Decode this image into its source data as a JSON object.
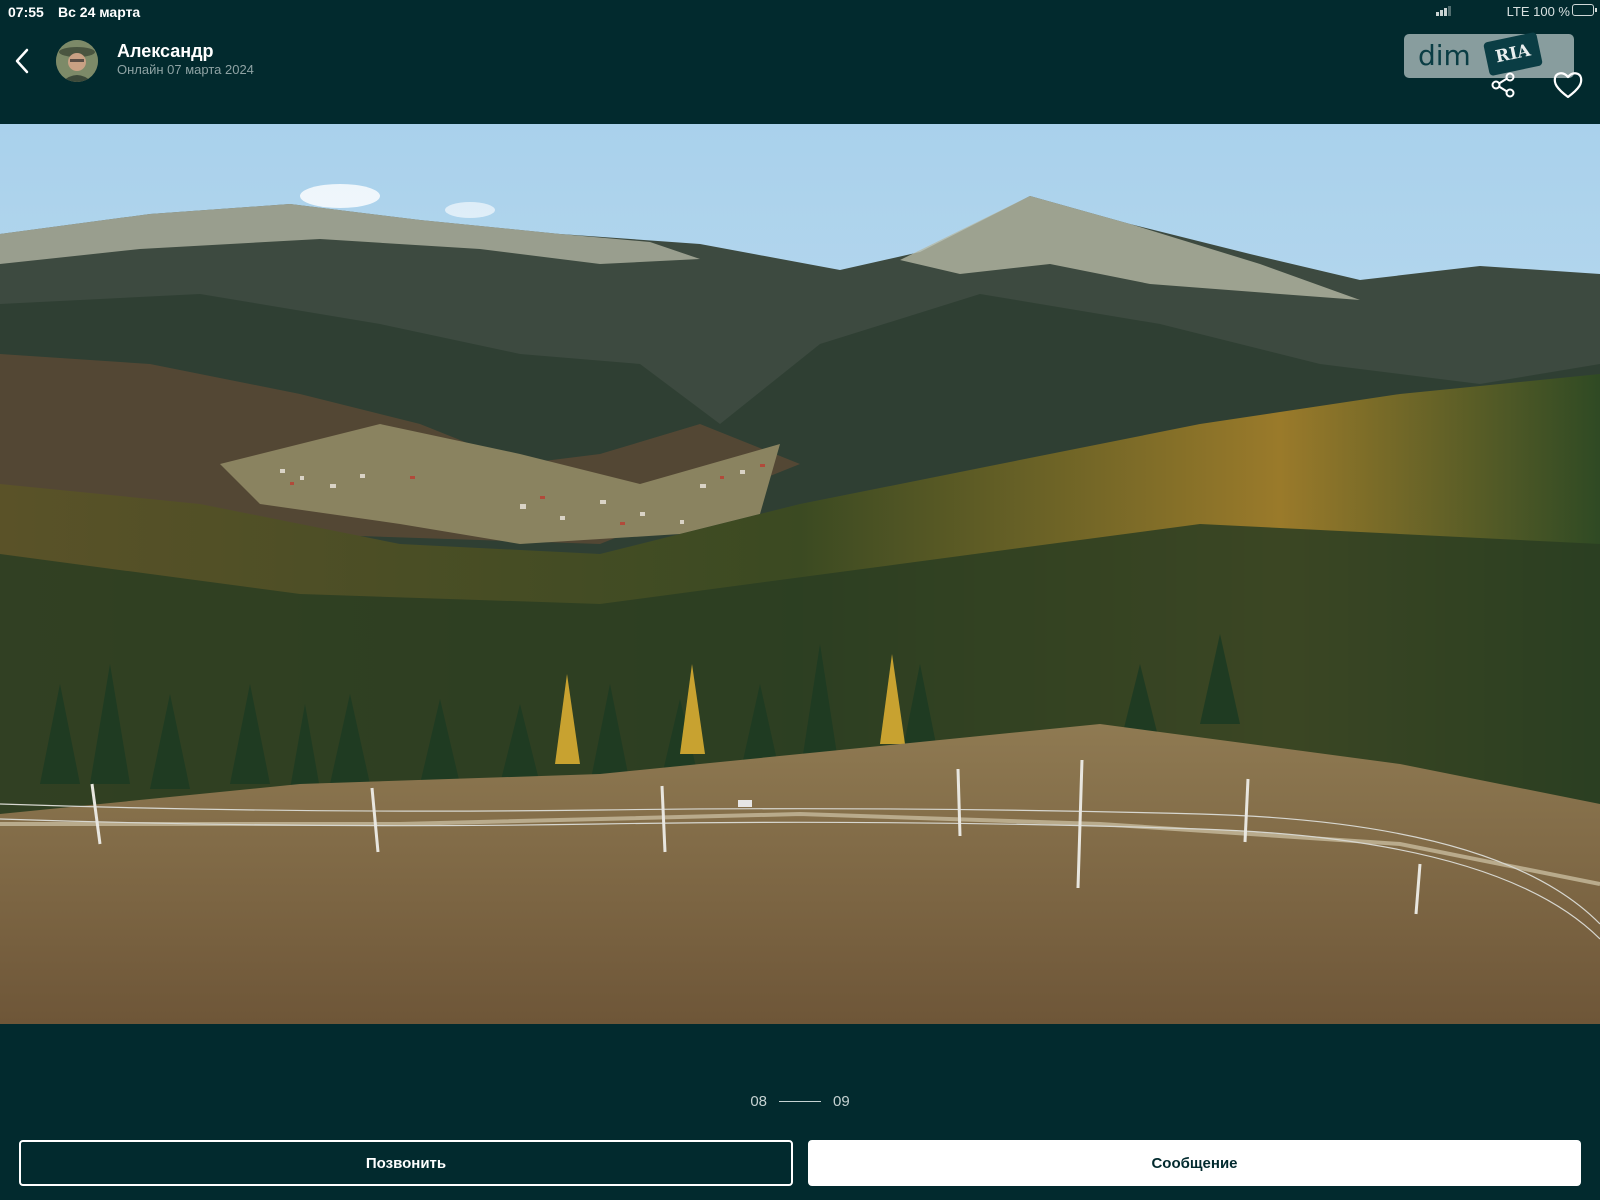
{
  "status_bar": {
    "time": "07:55",
    "date": "Вс 24 марта",
    "network": "LTE 100 %",
    "battery_level": 1.0,
    "battery_color": "#2fd158"
  },
  "header": {
    "back_icon": "chevron-left-icon",
    "user_name": "Александр",
    "user_status": "Онлайн 07 марта 2024",
    "share_icon": "share-icon",
    "favorite_icon": "heart-outline-icon"
  },
  "watermark": {
    "part1": "dim",
    "part2": "RIA"
  },
  "photo": {
    "description_icon": "landscape-photo"
  },
  "pager": {
    "current": "08",
    "total": "09"
  },
  "actions": {
    "call_label": "Позвонить",
    "message_label": "Сообщение"
  },
  "colors": {
    "background": "#022a2e",
    "accent_white": "#ffffff"
  }
}
